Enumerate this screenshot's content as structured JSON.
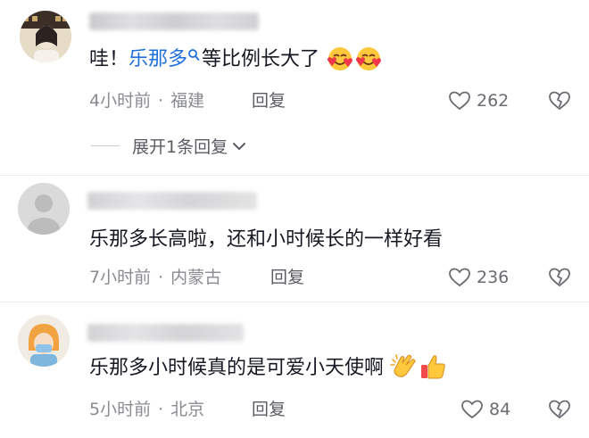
{
  "comments": [
    {
      "pre_text": "哇！",
      "mention": "乐那多",
      "post_text": "等比例长大了",
      "emojis": [
        "smiling-face-with-hearts",
        "smiling-face-with-hearts"
      ],
      "time": "4小时前",
      "location": "福建",
      "reply_label": "回复",
      "likes": "262",
      "expand_label": "展开1条回复"
    },
    {
      "text": "乐那多长高啦，还和小时候长的一样好看",
      "time": "7小时前",
      "location": "内蒙古",
      "reply_label": "回复",
      "likes": "236"
    },
    {
      "text": "乐那多小时候真的是可爱小天使啊",
      "emojis": [
        "clapping-hands",
        "thumbs-up"
      ],
      "time": "5小时前",
      "location": "北京",
      "reply_label": "回复",
      "likes": "84"
    }
  ],
  "icons": {
    "like": "heart-outline-icon",
    "dislike": "broken-heart-icon",
    "expand": "chevron-down-icon",
    "mention": "search-icon"
  },
  "colors": {
    "mention": "#1e6fd9",
    "text": "#161823",
    "meta": "#8a8b91",
    "icon": "#6b6c72"
  }
}
